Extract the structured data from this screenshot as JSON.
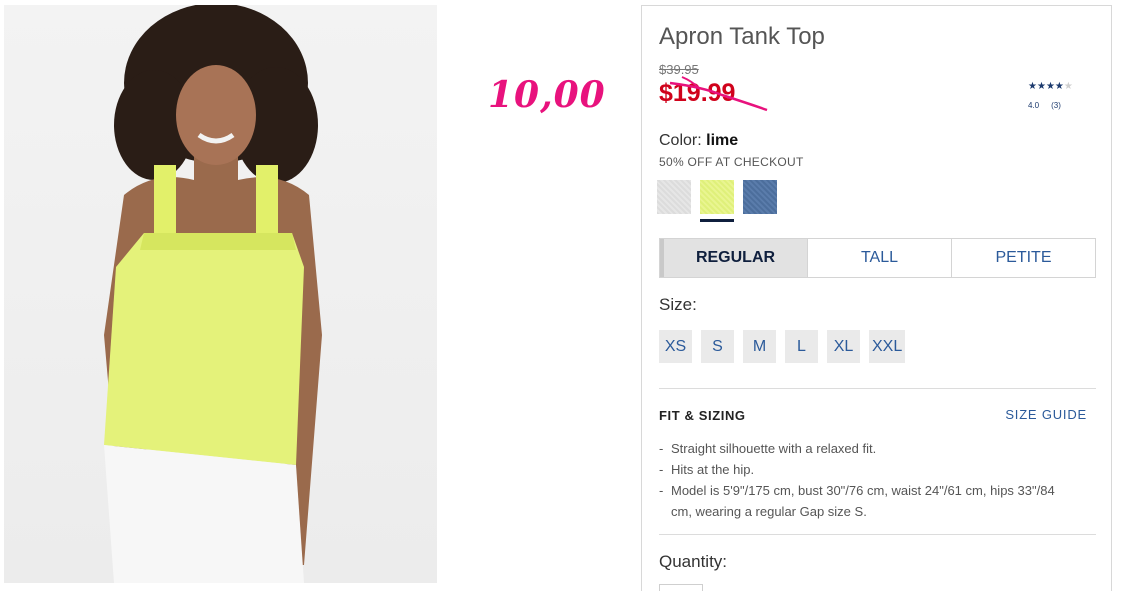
{
  "photo": {
    "alt": ""
  },
  "annotation": {
    "note": "10,00"
  },
  "product": {
    "title": "Apron Tank Top",
    "original_price": "$39.95",
    "sale_price": "$19.99",
    "rating": {
      "stars_filled": 4,
      "stars_total": 5,
      "score": "4.0",
      "count": "(3)"
    },
    "color_label": "Color: ",
    "color_value": "lime",
    "promo": "50% OFF AT CHECKOUT",
    "swatches": [
      {
        "name": "grey",
        "color": "#e1e1e1"
      },
      {
        "name": "lime",
        "color": "#e4f285",
        "selected": true
      },
      {
        "name": "blue",
        "color": "#5473a2"
      }
    ],
    "fits": [
      {
        "label": "REGULAR",
        "active": true
      },
      {
        "label": "TALL"
      },
      {
        "label": "PETITE"
      }
    ],
    "size_label": "Size:",
    "sizes": [
      "XS",
      "S",
      "M",
      "L",
      "XL",
      "XXL"
    ],
    "fit_sizing_title": "FIT & SIZING",
    "size_guide_label": "SIZE GUIDE",
    "fit_details": [
      "Straight silhouette with a relaxed fit.",
      "Hits at the hip.",
      "Model is 5'9\"/175 cm, bust 30\"/76 cm, waist 24\"/61 cm, hips 33\"/84 cm, wearing a regular Gap size S."
    ],
    "quantity_label": "Quantity:"
  },
  "colors": {
    "sale_red": "#d0021b",
    "link_blue": "#2b5a9a",
    "note_pink": "#e8127d",
    "navy": "#0f1f3d"
  }
}
